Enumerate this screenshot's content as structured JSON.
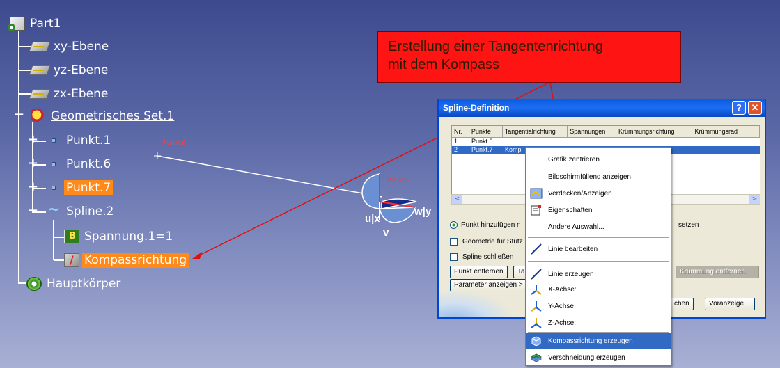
{
  "tree": {
    "root": "Part1",
    "xy_plane": "xy-Ebene",
    "yz_plane": "yz-Ebene",
    "zx_plane": "zx-Ebene",
    "geo_set": "Geometrisches Set.1",
    "point1": "Punkt.1",
    "point6": "Punkt.6",
    "point7": "Punkt.7",
    "spline": "Spline.2",
    "tension": "Spannung.1=1",
    "compass_dir": "Kompassrichtung",
    "main_body": "Hauptkörper"
  },
  "callout": {
    "line1": "Erstellung einer Tangentenrichtung",
    "line2": "mit dem Kompass"
  },
  "viewport": {
    "label_point6": "Punkt.6",
    "label_point7": "Punkt.7",
    "axis_u": "u|x",
    "axis_w": "w|y",
    "axis_v": "v"
  },
  "dialog": {
    "title": "Spline-Definition",
    "help": "?",
    "close": "✕",
    "columns": [
      "Nr.",
      "Punkte",
      "Tangentialrichtung",
      "Spannungen",
      "Krümmungsrichtung",
      "Krümmungsrad"
    ],
    "rows": [
      {
        "nr": "1",
        "point": "Punkt.6",
        "tangent": ""
      },
      {
        "nr": "2",
        "point": "Punkt.7",
        "tangent": "Komp"
      }
    ],
    "radio_add": "Punkt hinzufügen n",
    "radio_set": "setzen",
    "chk_support": "Geometrie für Stütz",
    "chk_close": "Spline schließen",
    "btn_remove_point": "Punkt entfernen",
    "btn_t": "Ta",
    "btn_remove_curv": "Krümmung entfernen",
    "btn_params": "Parameter anzeigen >",
    "btn_chen": "chen",
    "btn_preview": "Voranzeige"
  },
  "menu": {
    "center": "Grafik zentrieren",
    "fit": "Bildschirmfüllend anzeigen",
    "hide_show": "Verdecken/Anzeigen",
    "properties": "Eigenschaften",
    "other": "Andere Auswahl...",
    "edit_line": "Linie bearbeiten",
    "create_line": "Linie erzeugen",
    "x_axis": "X-Achse:",
    "y_axis": "Y-Achse",
    "z_axis": "Z-Achse:",
    "compass_dir": "Kompassrichtung erzeugen",
    "intersection": "Verschneidung erzeugen"
  },
  "colors": {
    "background_top": "#3d4a8e",
    "highlight": "#ff8a1c",
    "callout": "#ff1414",
    "menu_selection": "#316ac5"
  }
}
